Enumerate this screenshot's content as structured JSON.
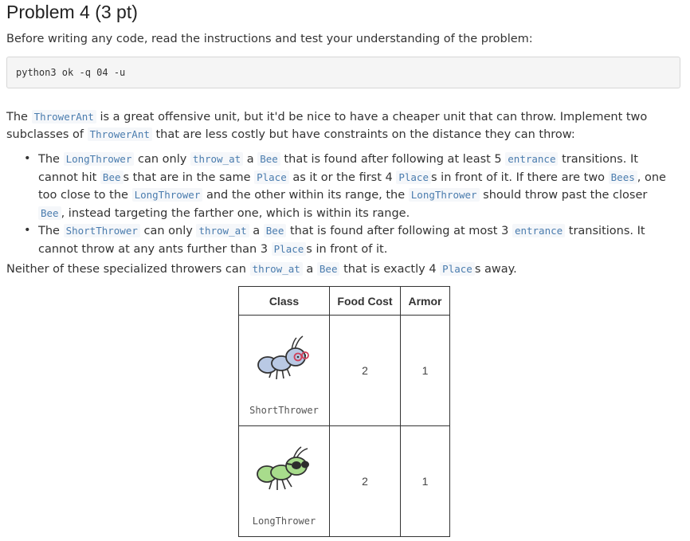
{
  "title": "Problem 4 (3 pt)",
  "intro": "Before writing any code, read the instructions and test your understanding of the problem:",
  "command": "python3 ok -q 04 -u",
  "para1": {
    "t1": "The ",
    "c1": "ThrowerAnt",
    "t2": " is a great offensive unit, but it'd be nice to have a cheaper unit that can throw. Implement two subclasses of ",
    "c2": "ThrowerAnt",
    "t3": " that are less costly but have constraints on the distance they can throw:"
  },
  "bullet1": {
    "t1": "The ",
    "c1": "LongThrower",
    "t2": " can only ",
    "c2": "throw_at",
    "t3": " a ",
    "c3": "Bee",
    "t4": " that is found after following at least 5 ",
    "c4": "entrance",
    "t5": " transitions. It cannot hit ",
    "c5": "Bee",
    "t6": "s that are in the same ",
    "c6": "Place",
    "t7": " as it or the first 4 ",
    "c7": "Place",
    "t8": "s in front of it. If there are two ",
    "c8": "Bees",
    "t9": ", one too close to the ",
    "c9": "LongThrower",
    "t10": " and the other within its range, the ",
    "c10": "LongThrower",
    "t11": " should throw past the closer ",
    "c11": "Bee",
    "t12": ", instead targeting the farther one, which is within its range."
  },
  "bullet2": {
    "t1": "The ",
    "c1": "ShortThrower",
    "t2": " can only ",
    "c2": "throw_at",
    "t3": " a ",
    "c3": "Bee",
    "t4": " that is found after following at most 3 ",
    "c4": "entrance",
    "t5": " transitions. It cannot throw at any ants further than 3 ",
    "c5": "Place",
    "t6": "s in front of it."
  },
  "para2": {
    "t1": "Neither of these specialized throwers can ",
    "c1": "throw_at",
    "t2": " a ",
    "c2": "Bee",
    "t3": " that is exactly 4 ",
    "c3": "Place",
    "t4": "s away."
  },
  "table": {
    "headers": {
      "class": "Class",
      "food_cost": "Food Cost",
      "armor": "Armor"
    },
    "rows": [
      {
        "icon": "short-thrower-ant-icon",
        "class": "ShortThrower",
        "food_cost": "2",
        "armor": "1"
      },
      {
        "icon": "long-thrower-ant-icon",
        "class": "LongThrower",
        "food_cost": "2",
        "armor": "1"
      }
    ]
  },
  "colors": {
    "code_text": "#4a7cae",
    "code_bg": "#f5f7fa",
    "cmd_bg": "#f5f5f5",
    "short_ant": "#b9c9e4",
    "long_ant": "#a8dc8c"
  }
}
